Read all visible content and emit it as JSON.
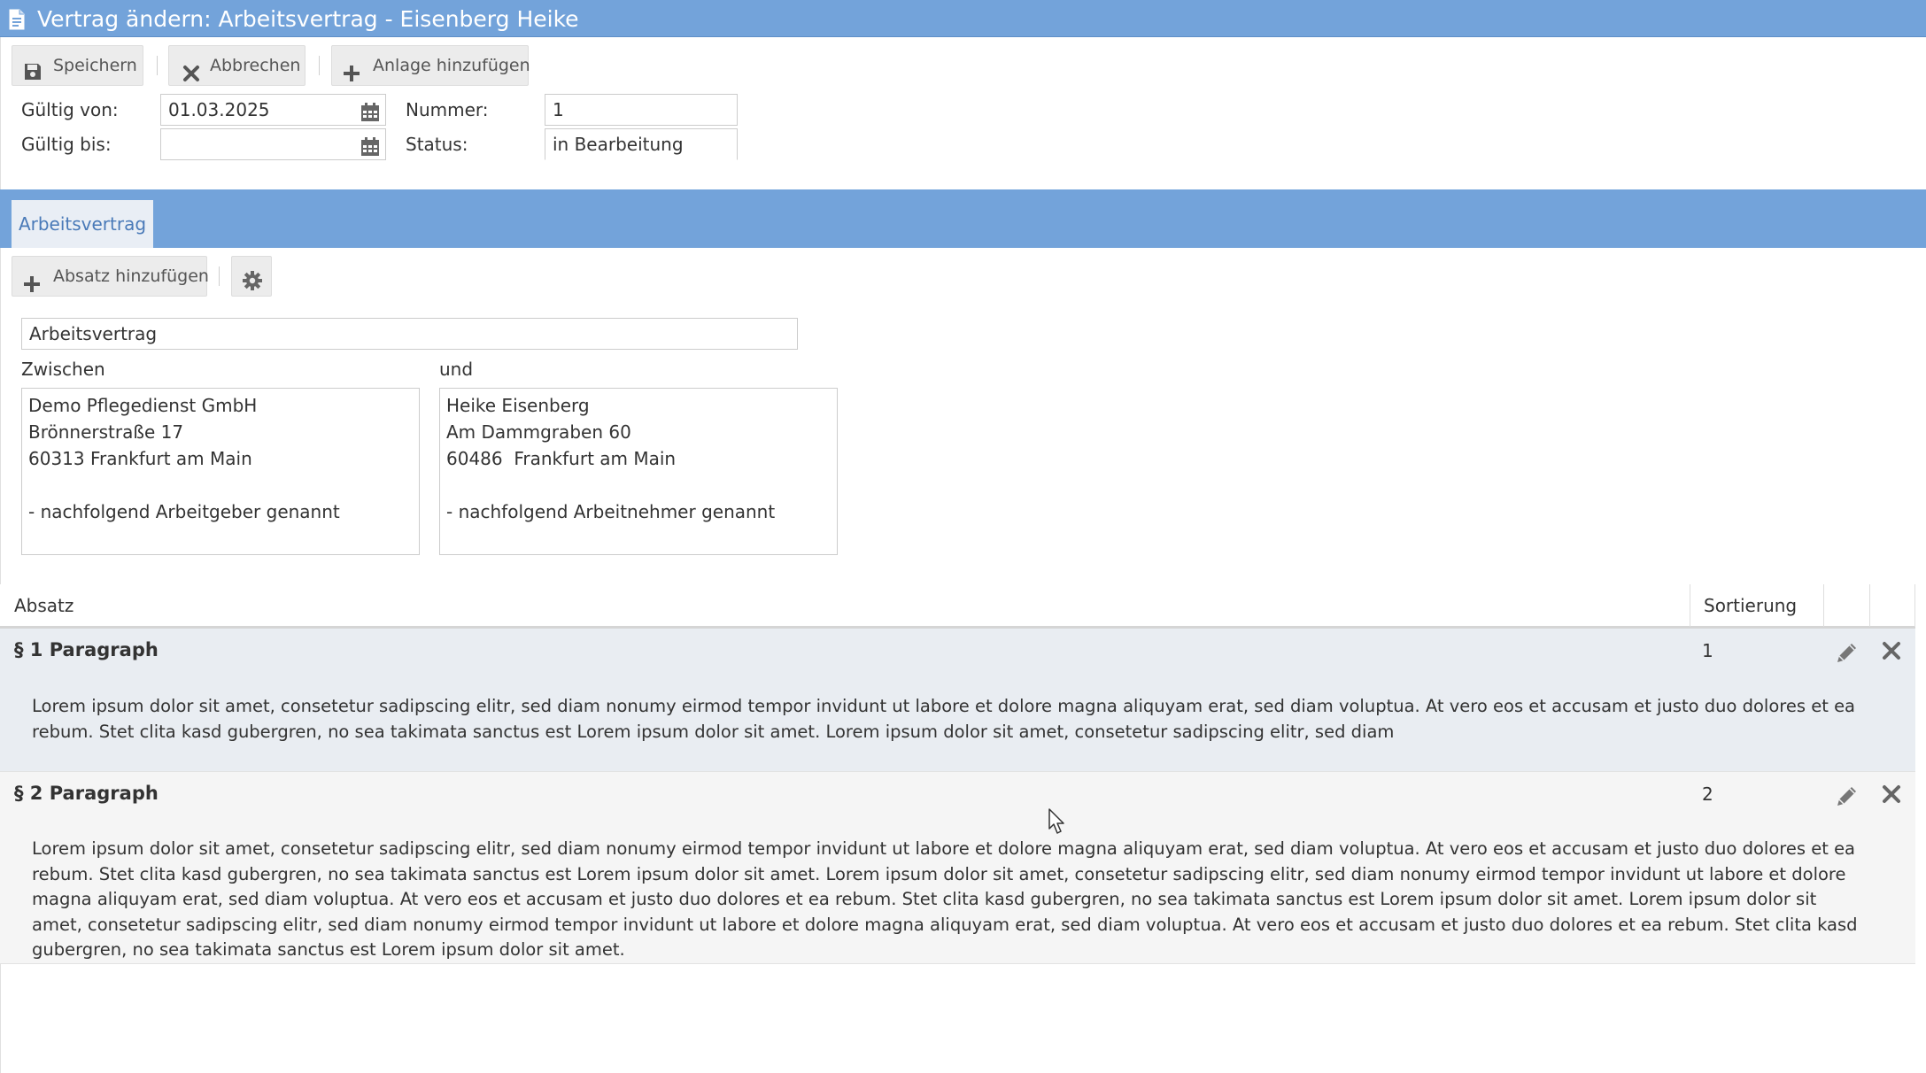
{
  "window": {
    "title": "Vertrag ändern: Arbeitsvertrag - Eisenberg Heike",
    "title_icon": "document-icon",
    "accent": "#73a3da"
  },
  "toolbar": {
    "save_label": "Speichern",
    "cancel_label": "Abbrechen",
    "add_attachment_label": "Anlage hinzufügen"
  },
  "form": {
    "valid_from_label": "Gültig von:",
    "valid_from_value": "01.03.2025",
    "valid_to_label": "Gültig bis:",
    "valid_to_value": "",
    "number_label": "Nummer:",
    "number_value": "1",
    "status_label": "Status:",
    "status_value": "in Bearbeitung"
  },
  "tabs": [
    {
      "label": "Arbeitsvertrag",
      "active": true
    }
  ],
  "section_toolbar": {
    "add_paragraph_label": "Absatz hinzufügen",
    "settings_icon": "gear-icon"
  },
  "contract": {
    "title_value": "Arbeitsvertrag",
    "between_label": "Zwischen",
    "and_label": "und",
    "employer_text": "Demo Pflegedienst GmbH\nBrönnerstraße 17\n60313 Frankfurt am Main\n\n- nachfolgend Arbeitgeber genannt",
    "employee_text": "Heike Eisenberg\nAm Dammgraben 60\n60486  Frankfurt am Main\n\n- nachfolgend Arbeitnehmer genannt"
  },
  "grid": {
    "col_paragraph": "Absatz",
    "col_sort": "Sortierung",
    "rows": [
      {
        "title": "§ 1 Paragraph",
        "sort": "1",
        "text": "Lorem ipsum dolor sit amet, consetetur sadipscing elitr, sed diam nonumy eirmod tempor invidunt ut labore et dolore magna aliquyam erat, sed diam voluptua. At vero eos et accusam et justo duo dolores et ea rebum. Stet clita kasd gubergren, no sea takimata sanctus est Lorem ipsum dolor sit amet. Lorem ipsum dolor sit amet, consetetur sadipscing elitr, sed diam"
      },
      {
        "title": "§ 2 Paragraph",
        "sort": "2",
        "text": "Lorem ipsum dolor sit amet, consetetur sadipscing elitr, sed diam nonumy eirmod tempor invidunt ut labore et dolore magna aliquyam erat, sed diam voluptua. At vero eos et accusam et justo duo dolores et ea rebum. Stet clita kasd gubergren, no sea takimata sanctus est Lorem ipsum dolor sit amet. Lorem ipsum dolor sit amet, consetetur sadipscing elitr, sed diam nonumy eirmod tempor invidunt ut labore et dolore magna aliquyam erat, sed diam voluptua. At vero eos et accusam et justo duo dolores et ea rebum. Stet clita kasd gubergren, no sea takimata sanctus est Lorem ipsum dolor sit amet. Lorem ipsum dolor sit amet, consetetur sadipscing elitr, sed diam nonumy eirmod tempor invidunt ut labore et dolore magna aliquyam erat, sed diam voluptua. At vero eos et accusam et justo duo dolores et ea rebum. Stet clita kasd gubergren, no sea takimata sanctus est Lorem ipsum dolor sit amet."
      }
    ]
  }
}
